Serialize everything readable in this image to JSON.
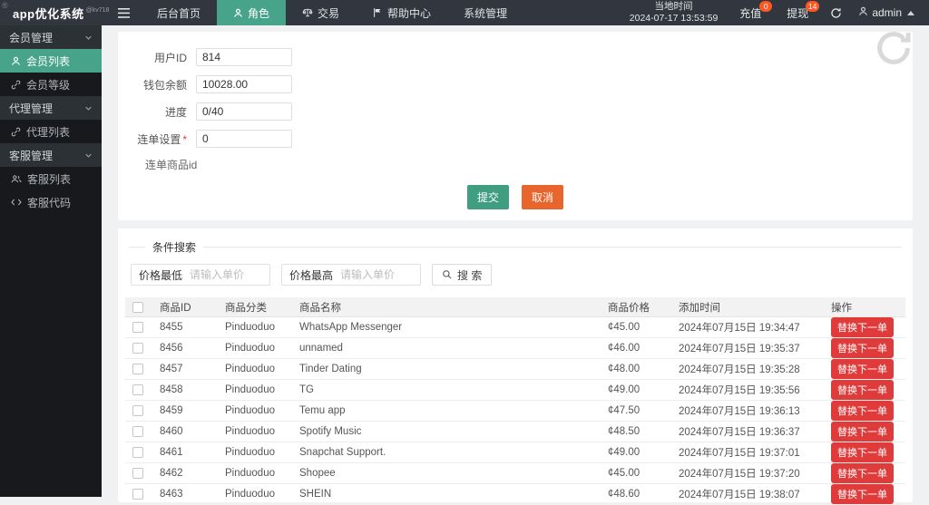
{
  "navbar": {
    "logo": "app优化系统",
    "logo_sub": "@kv718",
    "corner_mark": "®",
    "menu": [
      {
        "label": "后台首页"
      },
      {
        "label": "角色"
      },
      {
        "label": "交易"
      },
      {
        "label": "帮助中心"
      },
      {
        "label": "系统管理"
      }
    ],
    "local_time_label": "当地时间",
    "local_time_value": "2024-07-17 13:53:59",
    "recharge_label": "充值",
    "recharge_badge": "0",
    "withdraw_label": "提现",
    "withdraw_badge": "14",
    "username": "admin"
  },
  "sidebar": {
    "groups": [
      {
        "label": "会员管理",
        "items": [
          {
            "label": "会员列表"
          },
          {
            "label": "会员等级"
          }
        ]
      },
      {
        "label": "代理管理",
        "items": [
          {
            "label": "代理列表"
          }
        ]
      },
      {
        "label": "客服管理",
        "items": [
          {
            "label": "客服列表"
          },
          {
            "label": "客服代码"
          }
        ]
      }
    ]
  },
  "form": {
    "user_id_label": "用户ID",
    "user_id_value": "814",
    "wallet_label": "钱包余额",
    "wallet_value": "10028.00",
    "progress_label": "进度",
    "progress_value": "0/40",
    "chain_label": "连单设置",
    "chain_required_mark": "*",
    "chain_value": "0",
    "chain_product_label": "连单商品id",
    "submit_label": "提交",
    "cancel_label": "取消"
  },
  "search": {
    "legend": "条件搜索",
    "min_price_label": "价格最低",
    "min_price_placeholder": "请输入单价",
    "max_price_label": "价格最高",
    "max_price_placeholder": "请输入单价",
    "search_label": "搜 索"
  },
  "table": {
    "headers": {
      "id": "商品ID",
      "category": "商品分类",
      "name": "商品名称",
      "price": "商品价格",
      "time": "添加时间",
      "op": "操作"
    },
    "action_label": "替换下一单",
    "rows": [
      {
        "id": "8455",
        "category": "Pinduoduo",
        "name": "WhatsApp Messenger",
        "price": "¢45.00",
        "time": "2024年07月15日 19:34:47"
      },
      {
        "id": "8456",
        "category": "Pinduoduo",
        "name": "unnamed",
        "price": "¢46.00",
        "time": "2024年07月15日 19:35:37"
      },
      {
        "id": "8457",
        "category": "Pinduoduo",
        "name": "Tinder Dating",
        "price": "¢48.00",
        "time": "2024年07月15日 19:35:28"
      },
      {
        "id": "8458",
        "category": "Pinduoduo",
        "name": "TG",
        "price": "¢49.00",
        "time": "2024年07月15日 19:35:56"
      },
      {
        "id": "8459",
        "category": "Pinduoduo",
        "name": "Temu app",
        "price": "¢47.50",
        "time": "2024年07月15日 19:36:13"
      },
      {
        "id": "8460",
        "category": "Pinduoduo",
        "name": "Spotify Music",
        "price": "¢48.50",
        "time": "2024年07月15日 19:36:37"
      },
      {
        "id": "8461",
        "category": "Pinduoduo",
        "name": "Snapchat Support.",
        "price": "¢49.00",
        "time": "2024年07月15日 19:37:01"
      },
      {
        "id": "8462",
        "category": "Pinduoduo",
        "name": "Shopee",
        "price": "¢45.00",
        "time": "2024年07月15日 19:37:20"
      },
      {
        "id": "8463",
        "category": "Pinduoduo",
        "name": "SHEIN",
        "price": "¢48.60",
        "time": "2024年07月15日 19:38:07"
      }
    ]
  },
  "colors": {
    "accent_green": "#47a38a",
    "submit_green": "#3f9e80",
    "cancel_orange": "#e8662e",
    "action_red": "#e03b3b",
    "badge_orange": "#ff5722",
    "topbar_bg": "#31363f",
    "sidebar_bg": "#17191c"
  }
}
